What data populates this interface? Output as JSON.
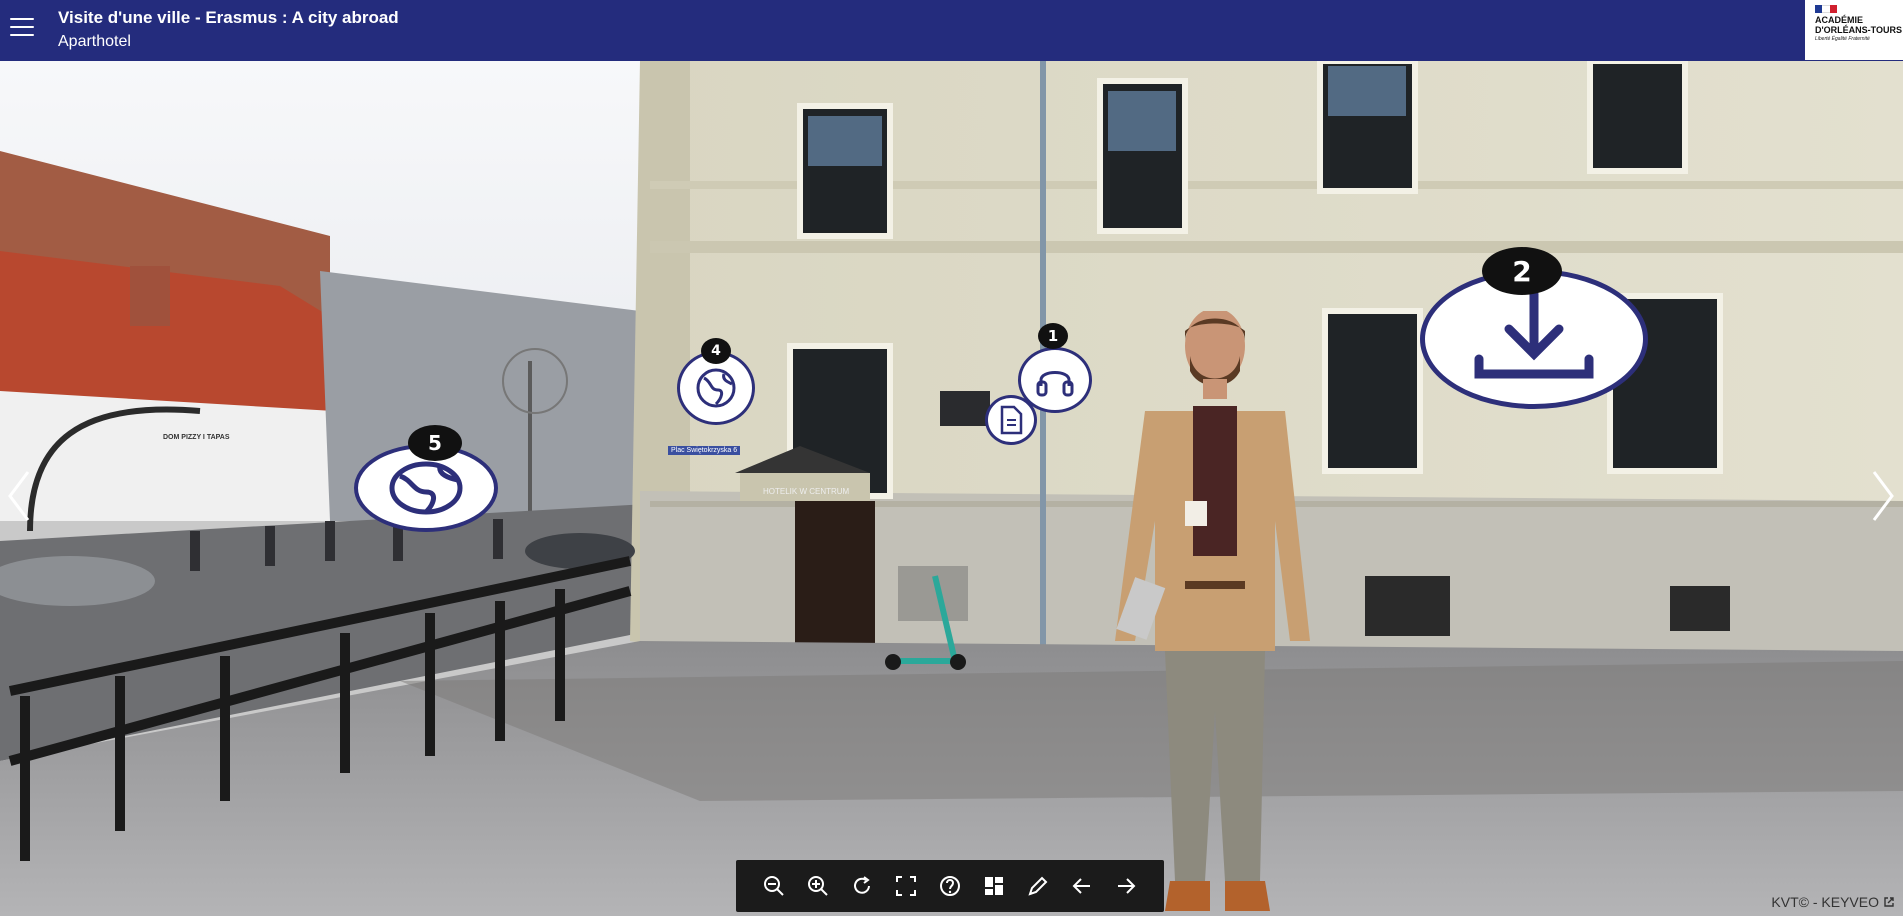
{
  "header": {
    "title": "Visite d'une ville - Erasmus : A city abroad",
    "subtitle": "Aparthotel",
    "logo": {
      "line1": "ACADÉMIE",
      "line2": "D'ORLÉANS-TOURS",
      "line3": "Liberté Égalité Fraternité"
    }
  },
  "scene": {
    "shop_sign": "DOM PIZZY I TAPAS",
    "hotel_sign": "HOTELIK W CENTRUM",
    "street_sign": "Plac Swiętokrzyska 6"
  },
  "hotspots": [
    {
      "number": "1",
      "icon": "headphones-icon"
    },
    {
      "number": "2",
      "icon": "download-icon"
    },
    {
      "number": "4",
      "icon": "globe-icon"
    },
    {
      "number": "5",
      "icon": "globe-icon"
    },
    {
      "number": "",
      "icon": "document-icon"
    }
  ],
  "toolbar": {
    "buttons": [
      "zoom-out-icon",
      "zoom-in-icon",
      "rotate-icon",
      "fullscreen-icon",
      "help-icon",
      "gallery-icon",
      "pen-icon",
      "arrow-left-icon",
      "arrow-right-icon"
    ]
  },
  "footer": {
    "credit": "KVT© - KEYVEO"
  },
  "colors": {
    "header_bg": "#242c7d",
    "hotspot_border": "#2d2f7a",
    "toolbar_bg": "#1b1b1b"
  }
}
